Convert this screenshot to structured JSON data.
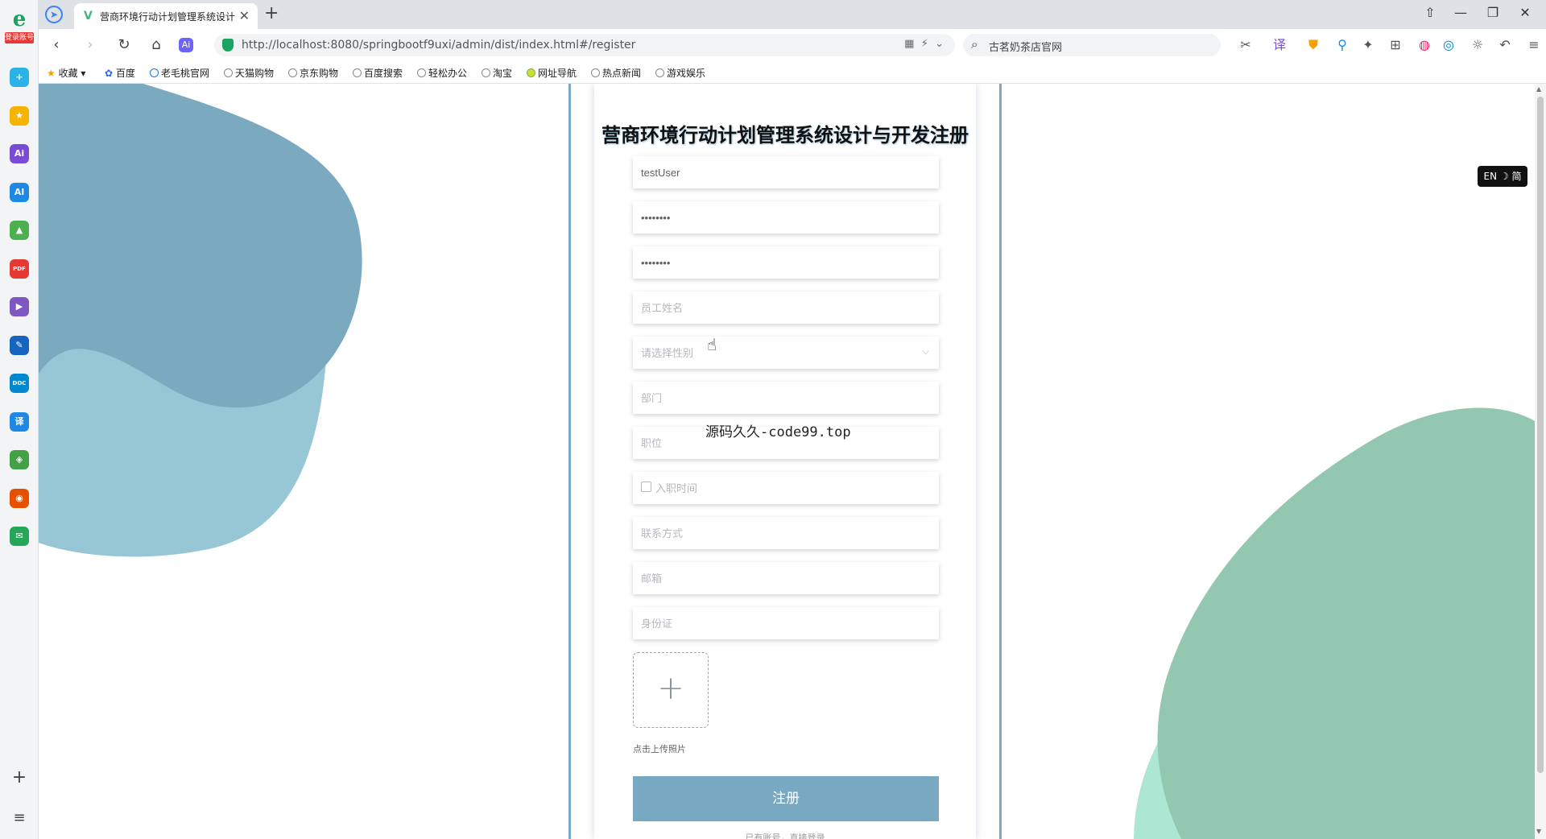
{
  "sidebar": {
    "logo_tag": "登录账号",
    "apps": [
      {
        "name": "app-health-icon",
        "color": "#2bb0e8",
        "glyph": "+"
      },
      {
        "name": "app-favorites-icon",
        "color": "#f5b400",
        "glyph": "★"
      },
      {
        "name": "app-ai-icon",
        "color": "#7b4bd6",
        "glyph": "Ai"
      },
      {
        "name": "app-ai-writer-icon",
        "color": "#1e88e5",
        "glyph": "AI"
      },
      {
        "name": "app-photo-icon",
        "color": "#4caf50",
        "glyph": "▲"
      },
      {
        "name": "app-pdf-icon",
        "color": "#e53935",
        "glyph": "PDF"
      },
      {
        "name": "app-video-icon",
        "color": "#7e57c2",
        "glyph": "▶"
      },
      {
        "name": "app-notes-icon",
        "color": "#1565c0",
        "glyph": "✎"
      },
      {
        "name": "app-doc-icon",
        "color": "#0288d1",
        "glyph": "DOC"
      },
      {
        "name": "app-translate-icon",
        "color": "#1e88e5",
        "glyph": "译"
      },
      {
        "name": "app-map-icon",
        "color": "#43a047",
        "glyph": "◈"
      },
      {
        "name": "app-weibo-icon",
        "color": "#e65100",
        "glyph": "◉"
      },
      {
        "name": "app-mail-icon",
        "color": "#26a65b",
        "glyph": "✉"
      }
    ],
    "add_glyph": "+",
    "menu_glyph": "≡"
  },
  "browser": {
    "tab_title": "营商环境行动计划管理系统设计",
    "tab_close": "✕",
    "new_tab": "+",
    "url": "http://localhost:8080/springbootf9uxi/admin/dist/index.html#/register",
    "search_text": "古茗奶茶店官网",
    "bookmarks": [
      "收藏",
      "百度",
      "老毛桃官网",
      "天猫购物",
      "京东购物",
      "百度搜索",
      "轻松办公",
      "淘宝",
      "网址导航",
      "热点新闻",
      "游戏娱乐"
    ]
  },
  "form": {
    "title": "营商环境行动计划管理系统设计与开发注册",
    "username_value": "testUser",
    "password_value": "12345678",
    "confirm_password_value": "12345678",
    "name_placeholder": "员工姓名",
    "gender_placeholder": "请选择性别",
    "department_placeholder": "部门",
    "position_placeholder": "职位",
    "hire_date_placeholder": "入职时间",
    "phone_placeholder": "联系方式",
    "email_placeholder": "邮箱",
    "id_card_placeholder": "身份证",
    "upload_hint": "点击上传照片",
    "register_label": "注册",
    "login_link": "已有账号，直接登录"
  },
  "watermark": "源码久久-code99.top",
  "lang_badge": "EN ☽ 简",
  "colors": {
    "accent": "#79a8c2",
    "blob_blue": "#7aa9c0",
    "blob_light_blue": "#97c7d5",
    "blob_green": "#93c7b0",
    "blob_mint": "#aee6d4"
  }
}
